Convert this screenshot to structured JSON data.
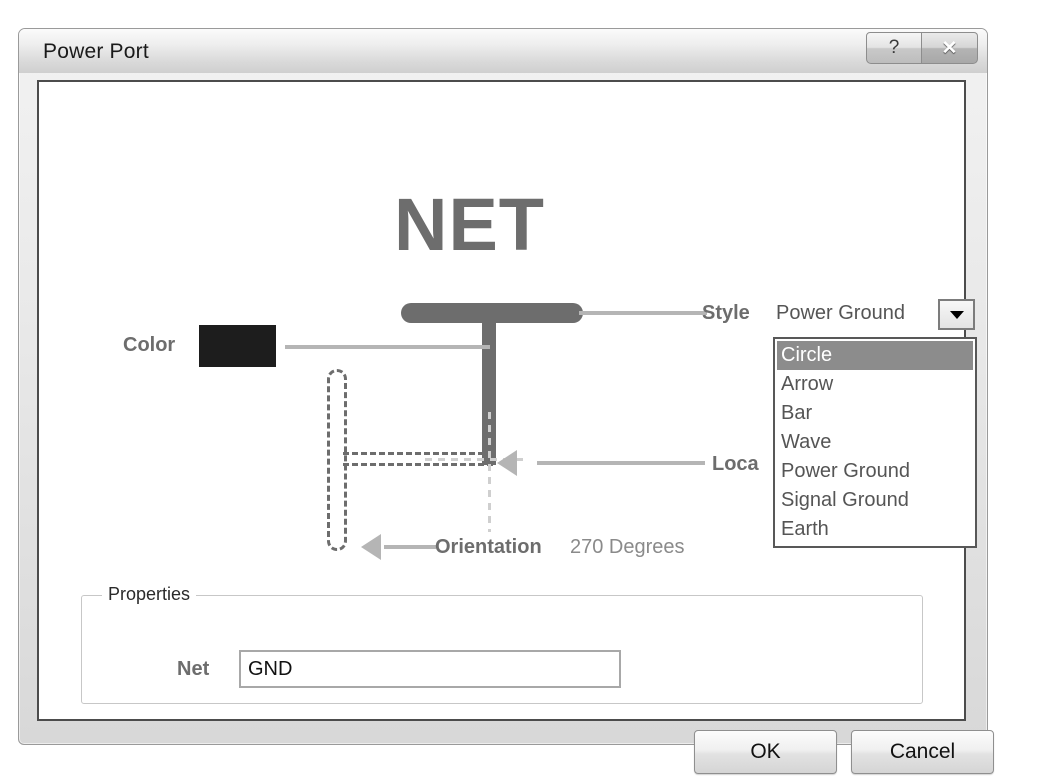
{
  "window": {
    "title": "Power Port",
    "help_button": "?",
    "close_button": "✕"
  },
  "preview": {
    "net_title": "NET",
    "color_label": "Color",
    "color_value": "#1d1d1d",
    "style_label": "Style",
    "location_label": "Loca",
    "location_label_full": "Location",
    "orientation_label": "Orientation",
    "orientation_value": "270 Degrees",
    "symbol_color": "#6d6d6d"
  },
  "style_combo": {
    "selected_value": "Power Ground",
    "arrow_icon": "chevron-down-icon",
    "options": [
      {
        "label": "Circle",
        "selected": true
      },
      {
        "label": "Arrow",
        "selected": false
      },
      {
        "label": "Bar",
        "selected": false
      },
      {
        "label": "Wave",
        "selected": false
      },
      {
        "label": "Power Ground",
        "selected": false
      },
      {
        "label": "Signal Ground",
        "selected": false
      },
      {
        "label": "Earth",
        "selected": false
      }
    ]
  },
  "properties": {
    "group_title": "Properties",
    "net_label": "Net",
    "net_value": "GND",
    "net_placeholder": ""
  },
  "buttons": {
    "ok": "OK",
    "cancel": "Cancel"
  }
}
